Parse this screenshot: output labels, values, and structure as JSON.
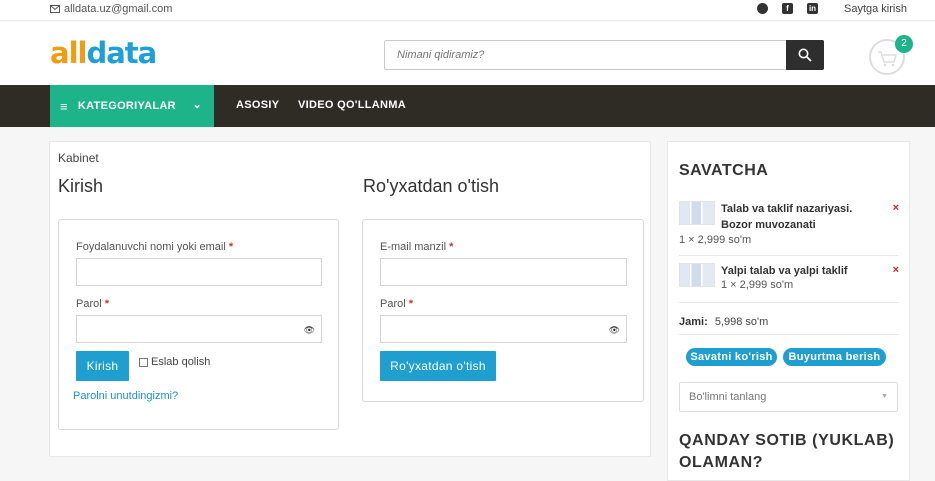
{
  "topbar": {
    "email": "alldata.uz@gmail.com",
    "socials": [
      {
        "icon": "telegram-icon",
        "glyph": ""
      },
      {
        "icon": "facebook-icon",
        "glyph": "f"
      },
      {
        "icon": "linkedin-icon",
        "glyph": "in"
      }
    ],
    "login": "Saytga kirish"
  },
  "header": {
    "logo": {
      "part1": "all",
      "part2": "data"
    },
    "search_placeholder": "Nimani qidiramiz?",
    "cart_count": "2"
  },
  "nav": {
    "categories": "KATEGORIYALAR",
    "links": [
      "ASOSIY",
      "VIDEO QO'LLANMA"
    ]
  },
  "main": {
    "breadcrumb": "Kabinet",
    "login": {
      "title": "Kirish",
      "username_label": "Foydalanuvchi nomi yoki email",
      "password_label": "Parol",
      "submit": "Kirish",
      "remember": "Eslab qolish",
      "forgot": "Parolni unutdingizmi?"
    },
    "register": {
      "title": "Ro'yxatdan o'tish",
      "email_label": "E-mail manzil",
      "password_label": "Parol",
      "submit": "Ro'yxatdan o'tish"
    },
    "required_mark": "*"
  },
  "sidebar": {
    "cart_title": "SAVATCHA",
    "items": [
      {
        "name": "Talab va taklif nazariyasi. Bozor muvozanati",
        "qty": "1 × 2,999 so'm",
        "remove": "×"
      },
      {
        "name": "Yalpi talab va yalpi taklif",
        "qty": "1 × 2,999 so'm",
        "remove": "×"
      }
    ],
    "total_label": "Jami:",
    "total_value": "5,998 so'm",
    "view_cart": "Savatni ko'rish",
    "checkout": "Buyurtma berish",
    "select_placeholder": "Bo'limni tanlang",
    "faq_title": "QANDAY SOTIB (YUKLAB) OLAMAN?"
  },
  "colors": {
    "accent_green": "#1eb48a",
    "accent_blue": "#1e9fd0",
    "nav_bg": "#2f2b25"
  }
}
